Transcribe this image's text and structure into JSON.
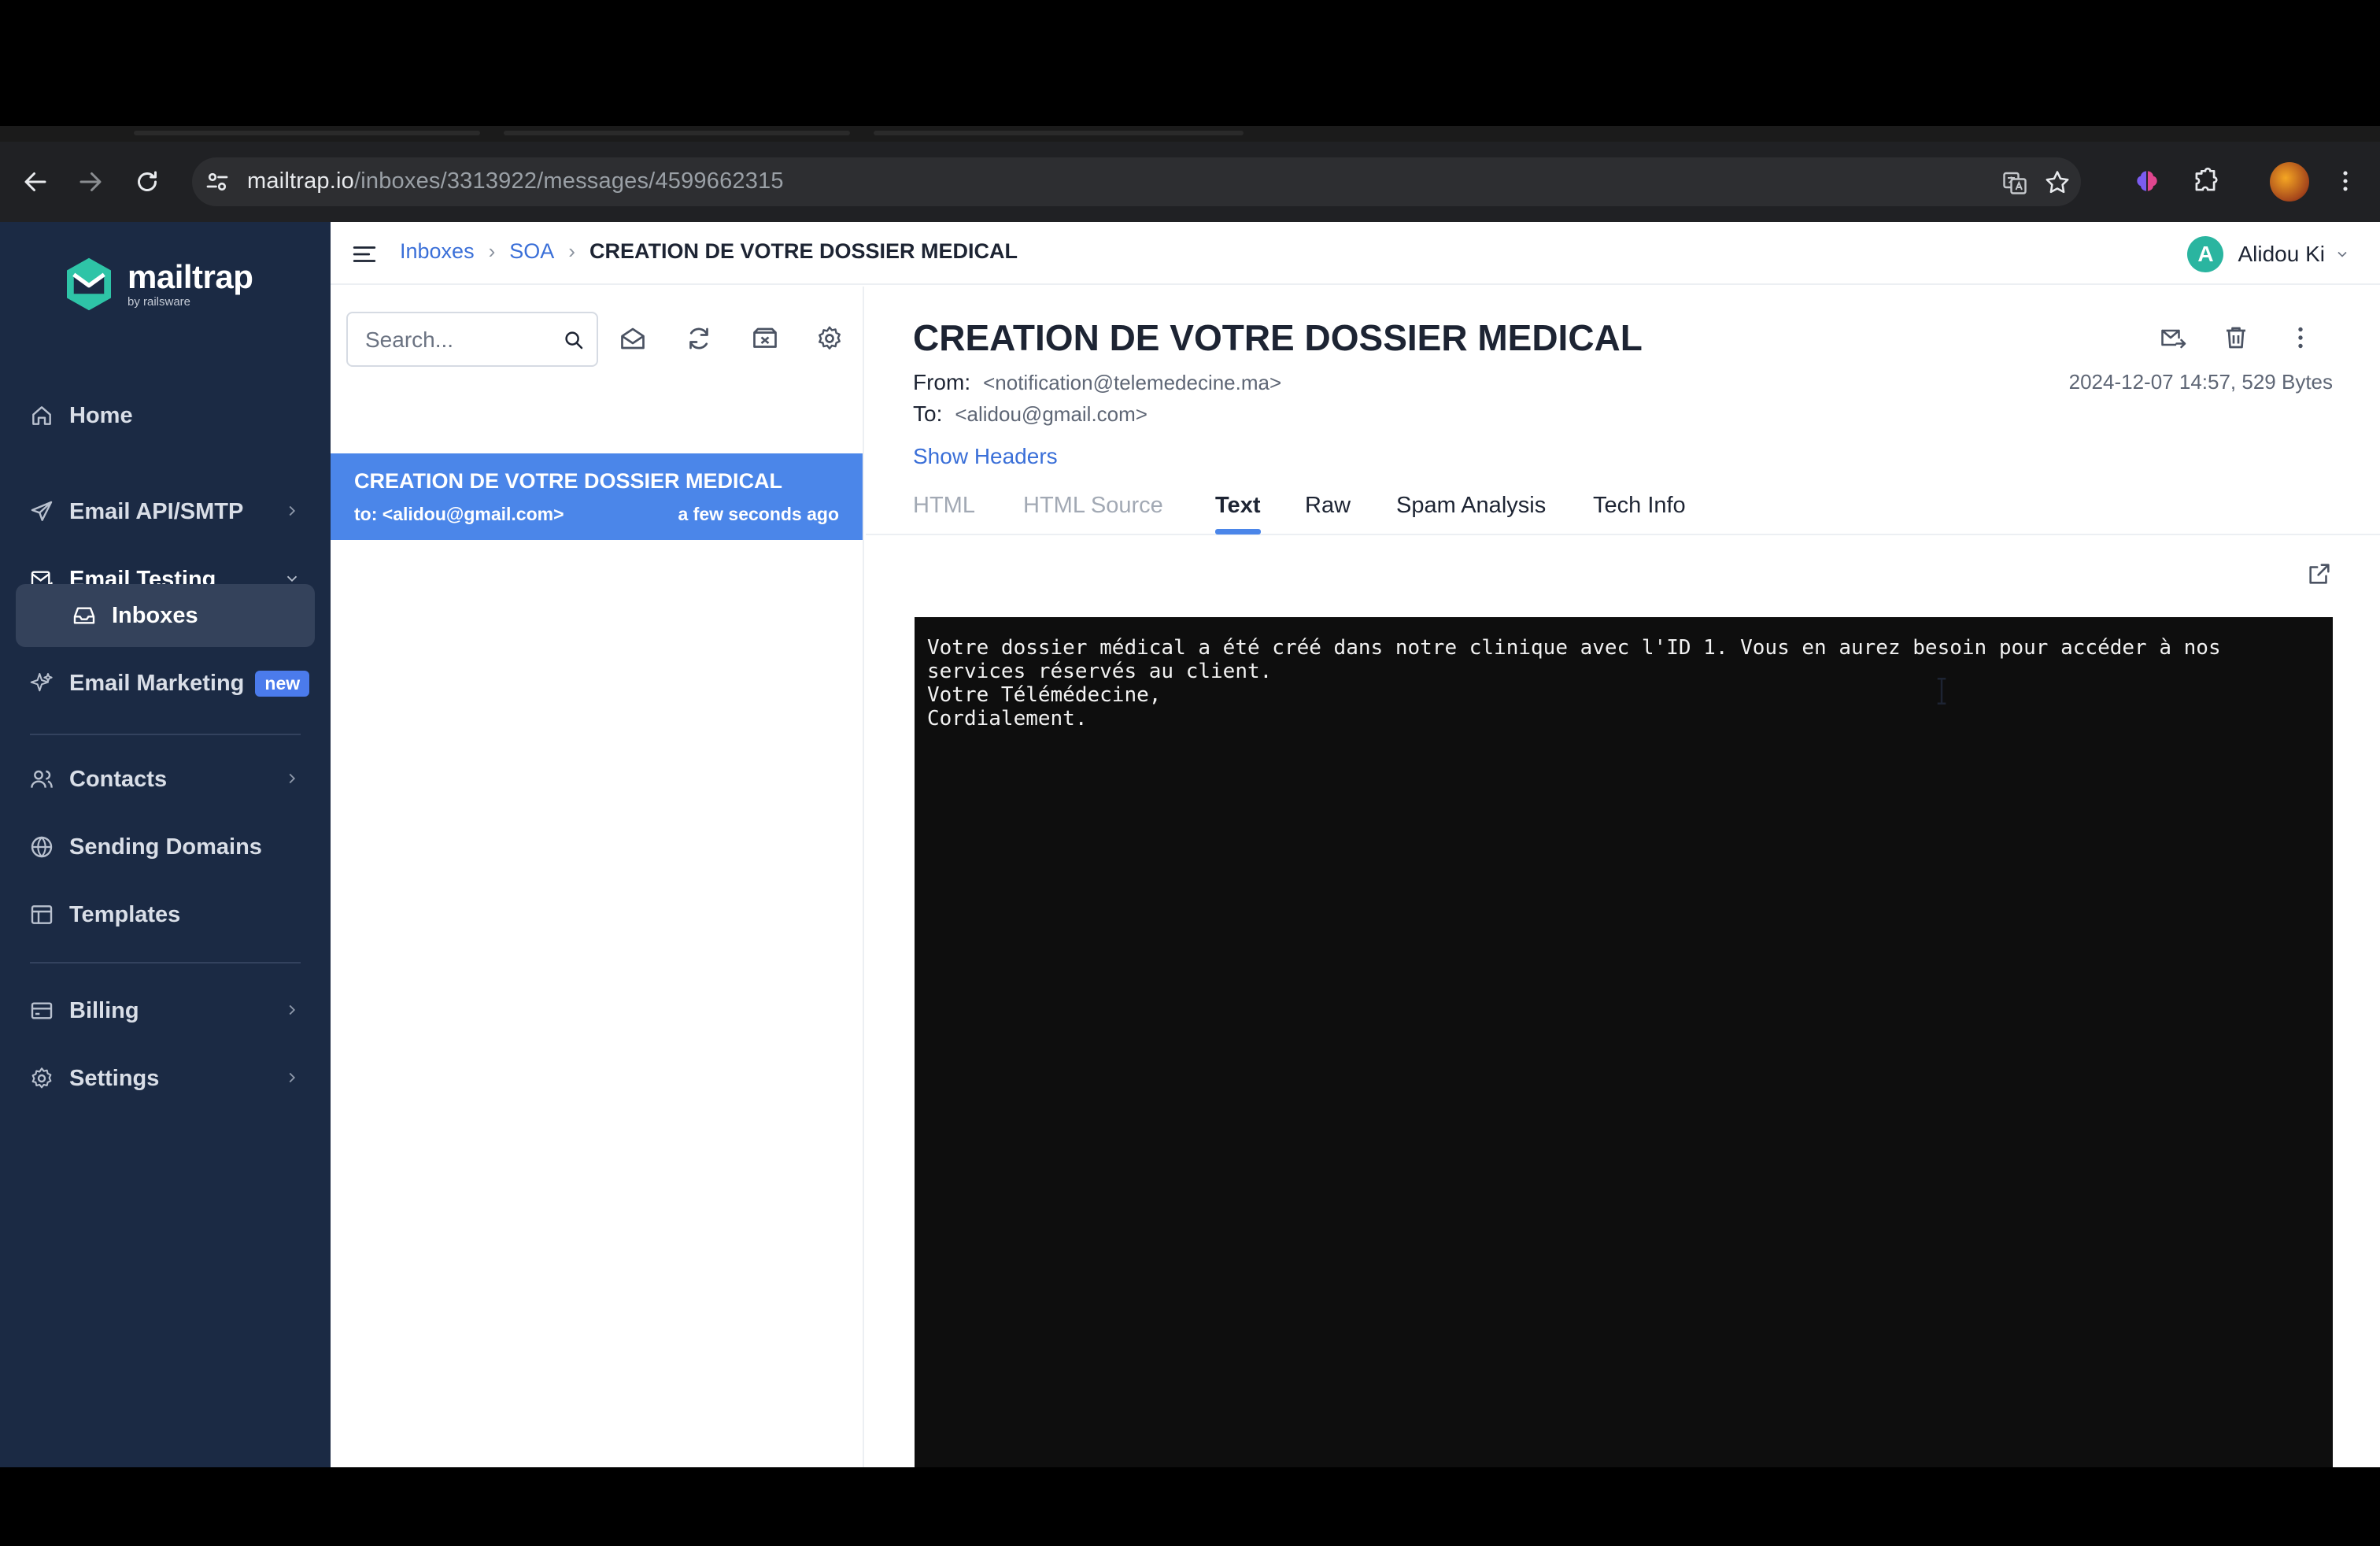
{
  "browser": {
    "url_host": "mailtrap.io",
    "url_path": "/inboxes/3313922/messages/4599662315"
  },
  "sidebar": {
    "logo_name": "mailtrap",
    "logo_sub": "by railsware",
    "items": [
      {
        "label": "Home"
      },
      {
        "label": "Email API/SMTP"
      },
      {
        "label": "Email Testing"
      },
      {
        "label": "Inboxes"
      },
      {
        "label": "Email Marketing",
        "badge": "new"
      },
      {
        "label": "Contacts"
      },
      {
        "label": "Sending Domains"
      },
      {
        "label": "Templates"
      },
      {
        "label": "Billing"
      },
      {
        "label": "Settings"
      }
    ]
  },
  "header": {
    "breadcrumb": [
      "Inboxes",
      "SOA",
      "CREATION DE VOTRE DOSSIER MEDICAL"
    ],
    "user_initial": "A",
    "user_name": "Alidou Ki"
  },
  "list": {
    "search_placeholder": "Search...",
    "messages": [
      {
        "subject": "CREATION DE VOTRE DOSSIER MEDICAL",
        "to": "to: <alidou@gmail.com>",
        "time": "a few seconds ago"
      }
    ]
  },
  "message": {
    "title": "CREATION DE VOTRE DOSSIER MEDICAL",
    "from_label": "From:",
    "from_value": "<notification@telemedecine.ma>",
    "to_label": "To:",
    "to_value": "<alidou@gmail.com>",
    "date_size": "2024-12-07 14:57, 529 Bytes",
    "show_headers": "Show Headers",
    "tabs": [
      "HTML",
      "HTML Source",
      "Text",
      "Raw",
      "Spam Analysis",
      "Tech Info"
    ],
    "active_tab": "Text",
    "body_text": "Votre dossier médical a été créé dans notre clinique avec l'ID 1. Vous en aurez besoin pour accéder à nos\nservices réservés au client.\nVotre Télémédecine,\nCordialement."
  },
  "colors": {
    "sidebar_bg": "#1b2a44",
    "accent": "#4b86e9",
    "link": "#3a6fd8",
    "badge": "#4b7bec"
  }
}
